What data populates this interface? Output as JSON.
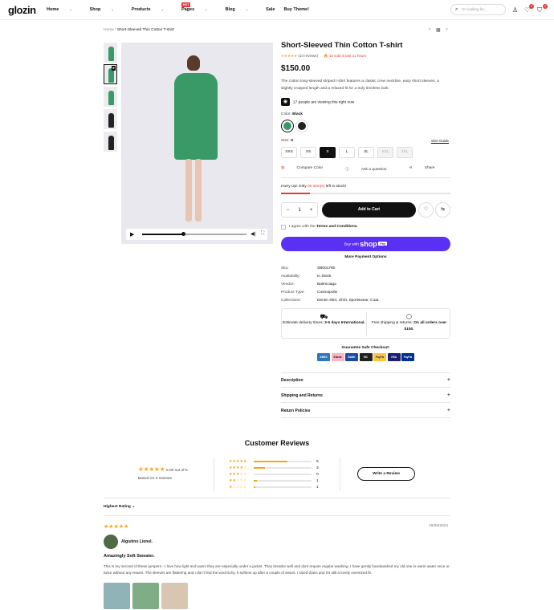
{
  "header": {
    "logo": "glozin",
    "nav": [
      {
        "label": "Home",
        "chevron": true
      },
      {
        "label": "Shop",
        "chevron": true
      },
      {
        "label": "Products",
        "chevron": true
      },
      {
        "label": "Pages",
        "chevron": true
      },
      {
        "label": "Blog",
        "chevron": true
      },
      {
        "label": "Sale",
        "chevron": false
      },
      {
        "label": "Buy Theme!",
        "chevron": false
      }
    ],
    "sale_badge": "HOT",
    "search_placeholder": "I'm looking for...",
    "wishlist_count": "0",
    "cart_count": "0"
  },
  "breadcrumb": {
    "home": "Home",
    "current": "Short-Sleeved Thin Cotton T-shirt"
  },
  "product": {
    "title": "Short-Sleeved Thin Cotton T-shirt",
    "stars": "★★★★★",
    "reviews": "(10 reviews)",
    "sold": "15 sold in last 31 hours",
    "price": "$150.00",
    "description": "The cotton long-sleeved striped t-shirt features a classic crew neckline, easy short sleeves, a slightly cropped length and a relaxed fit for a truly timeless look.",
    "viewing": "17 people are viewing this right now",
    "color_label": "Color:",
    "color_value": "Black",
    "size_label": "Size:",
    "size_value": "S",
    "size_guide": "Size Guide",
    "sizes": [
      "XXS",
      "XS",
      "S",
      "L",
      "XL",
      "XXL",
      "3XL"
    ],
    "compare": "Compare Color",
    "ask": "Ask a question",
    "share": "Share",
    "hurry_prefix": "Hurry Up! Only",
    "hurry_count": "05 item(s)",
    "hurry_suffix": "left in stock!",
    "stock_fraction": 0.17,
    "qty": "1",
    "add_to_cart": "Add to Cart",
    "agree_prefix": "I agree with the",
    "agree_link": "Terms and Conditions.",
    "buy_with": "Buy with",
    "shop_word": "shop",
    "pay_word": "Pay",
    "more_payment": "More Payment Options",
    "meta": [
      {
        "k": "Sku:",
        "v": "SB001780"
      },
      {
        "k": "Availability:",
        "v": "In Stock"
      },
      {
        "k": "Vendor:",
        "v": "Balenciaga"
      },
      {
        "k": "Product Type:",
        "v": "Cosmopolis"
      },
      {
        "k": "Collections:",
        "v": "Denim shirt, Shirt, Sportswear, Coat."
      }
    ],
    "delivery_text": "Estimate delivery times:",
    "delivery_bold": "3-5 days International.",
    "shipping_text": "Free shipping & returns:",
    "shipping_bold": "On all orders over $150.",
    "guarantee": "Guarantee Safe Checkout:",
    "cards": [
      "AMEX",
      "Klarna",
      "BANK",
      "MC",
      "PayPal",
      "VISA",
      "PayPal"
    ],
    "accordions": [
      "Description",
      "Shipping and Returns",
      "Return Policies"
    ]
  },
  "reviews": {
    "title": "Customer Reviews",
    "avg_stars": "★★★★★",
    "avg_text": "5.00 out of 5",
    "based": "Based on 3 reviews",
    "breakdown": [
      {
        "stars": "★★★★★",
        "fraction": 0.58,
        "count": "5"
      },
      {
        "stars": "★★★★☆",
        "fraction": 0.2,
        "count": "3"
      },
      {
        "stars": "★★★☆☆",
        "fraction": 0,
        "count": "0"
      },
      {
        "stars": "★★☆☆☆",
        "fraction": 0.05,
        "count": "1"
      },
      {
        "stars": "★☆☆☆☆",
        "fraction": 0.03,
        "count": "1"
      }
    ],
    "write": "Write a Review",
    "sort": "Highest Rating",
    "review": {
      "stars": "★★★★★",
      "date": "19/06/2024",
      "name": "Algistino Lionel.",
      "headline": "Amazingly Soft Sweater.",
      "body": "This is my second of these jumpers - I love how light and warm they are especially under a jacket. They breathe well and dont require regular washing. I have gently handwashed my old one in warm water once or twice without any issues. The sleeves are flattering and I don't find the wool itchy, it softens up after a couple of wears. I sized down and it's still a lovely oversized fit."
    }
  }
}
